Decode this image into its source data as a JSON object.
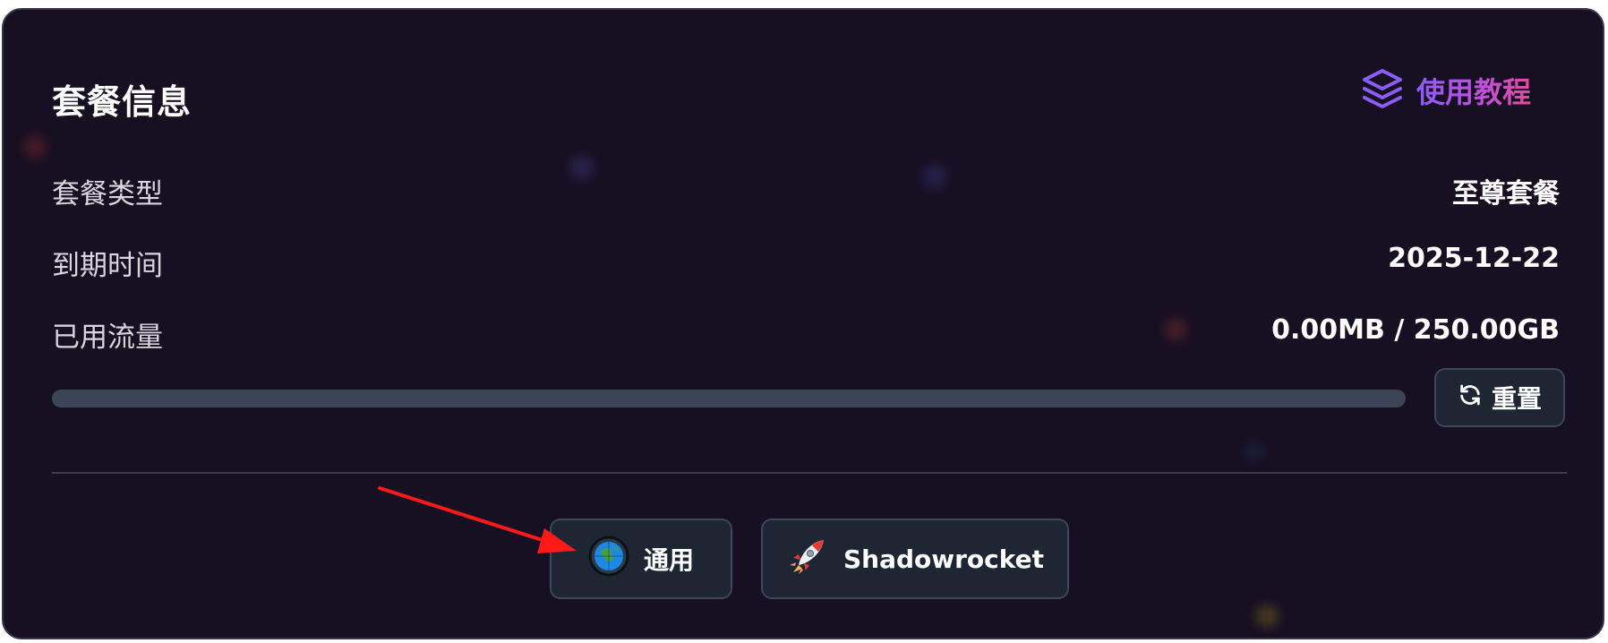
{
  "plan": {
    "title": "套餐信息",
    "tutorial": {
      "label": "使用教程",
      "icon": "layers-icon",
      "gradient": [
        "#8b5cf6",
        "#e14b9c"
      ]
    },
    "rows": [
      {
        "label": "套餐类型",
        "value": "至尊套餐"
      },
      {
        "label": "到期时间",
        "value": "2025-12-22"
      },
      {
        "label": "已用流量",
        "value": "0.00MB / 250.00GB"
      }
    ],
    "usage_fraction": 0,
    "reset": {
      "label": "重置",
      "icon": "refresh-icon"
    }
  },
  "clients": [
    {
      "label": "通用",
      "icon": "globe-icon"
    },
    {
      "label": "Shadowrocket",
      "icon": "rocket-icon"
    }
  ],
  "colors": {
    "background": "#170f22",
    "progress_track": "#3b4556",
    "button_bg": "#1f2633",
    "annotation_arrow": "#ff1a1a"
  }
}
